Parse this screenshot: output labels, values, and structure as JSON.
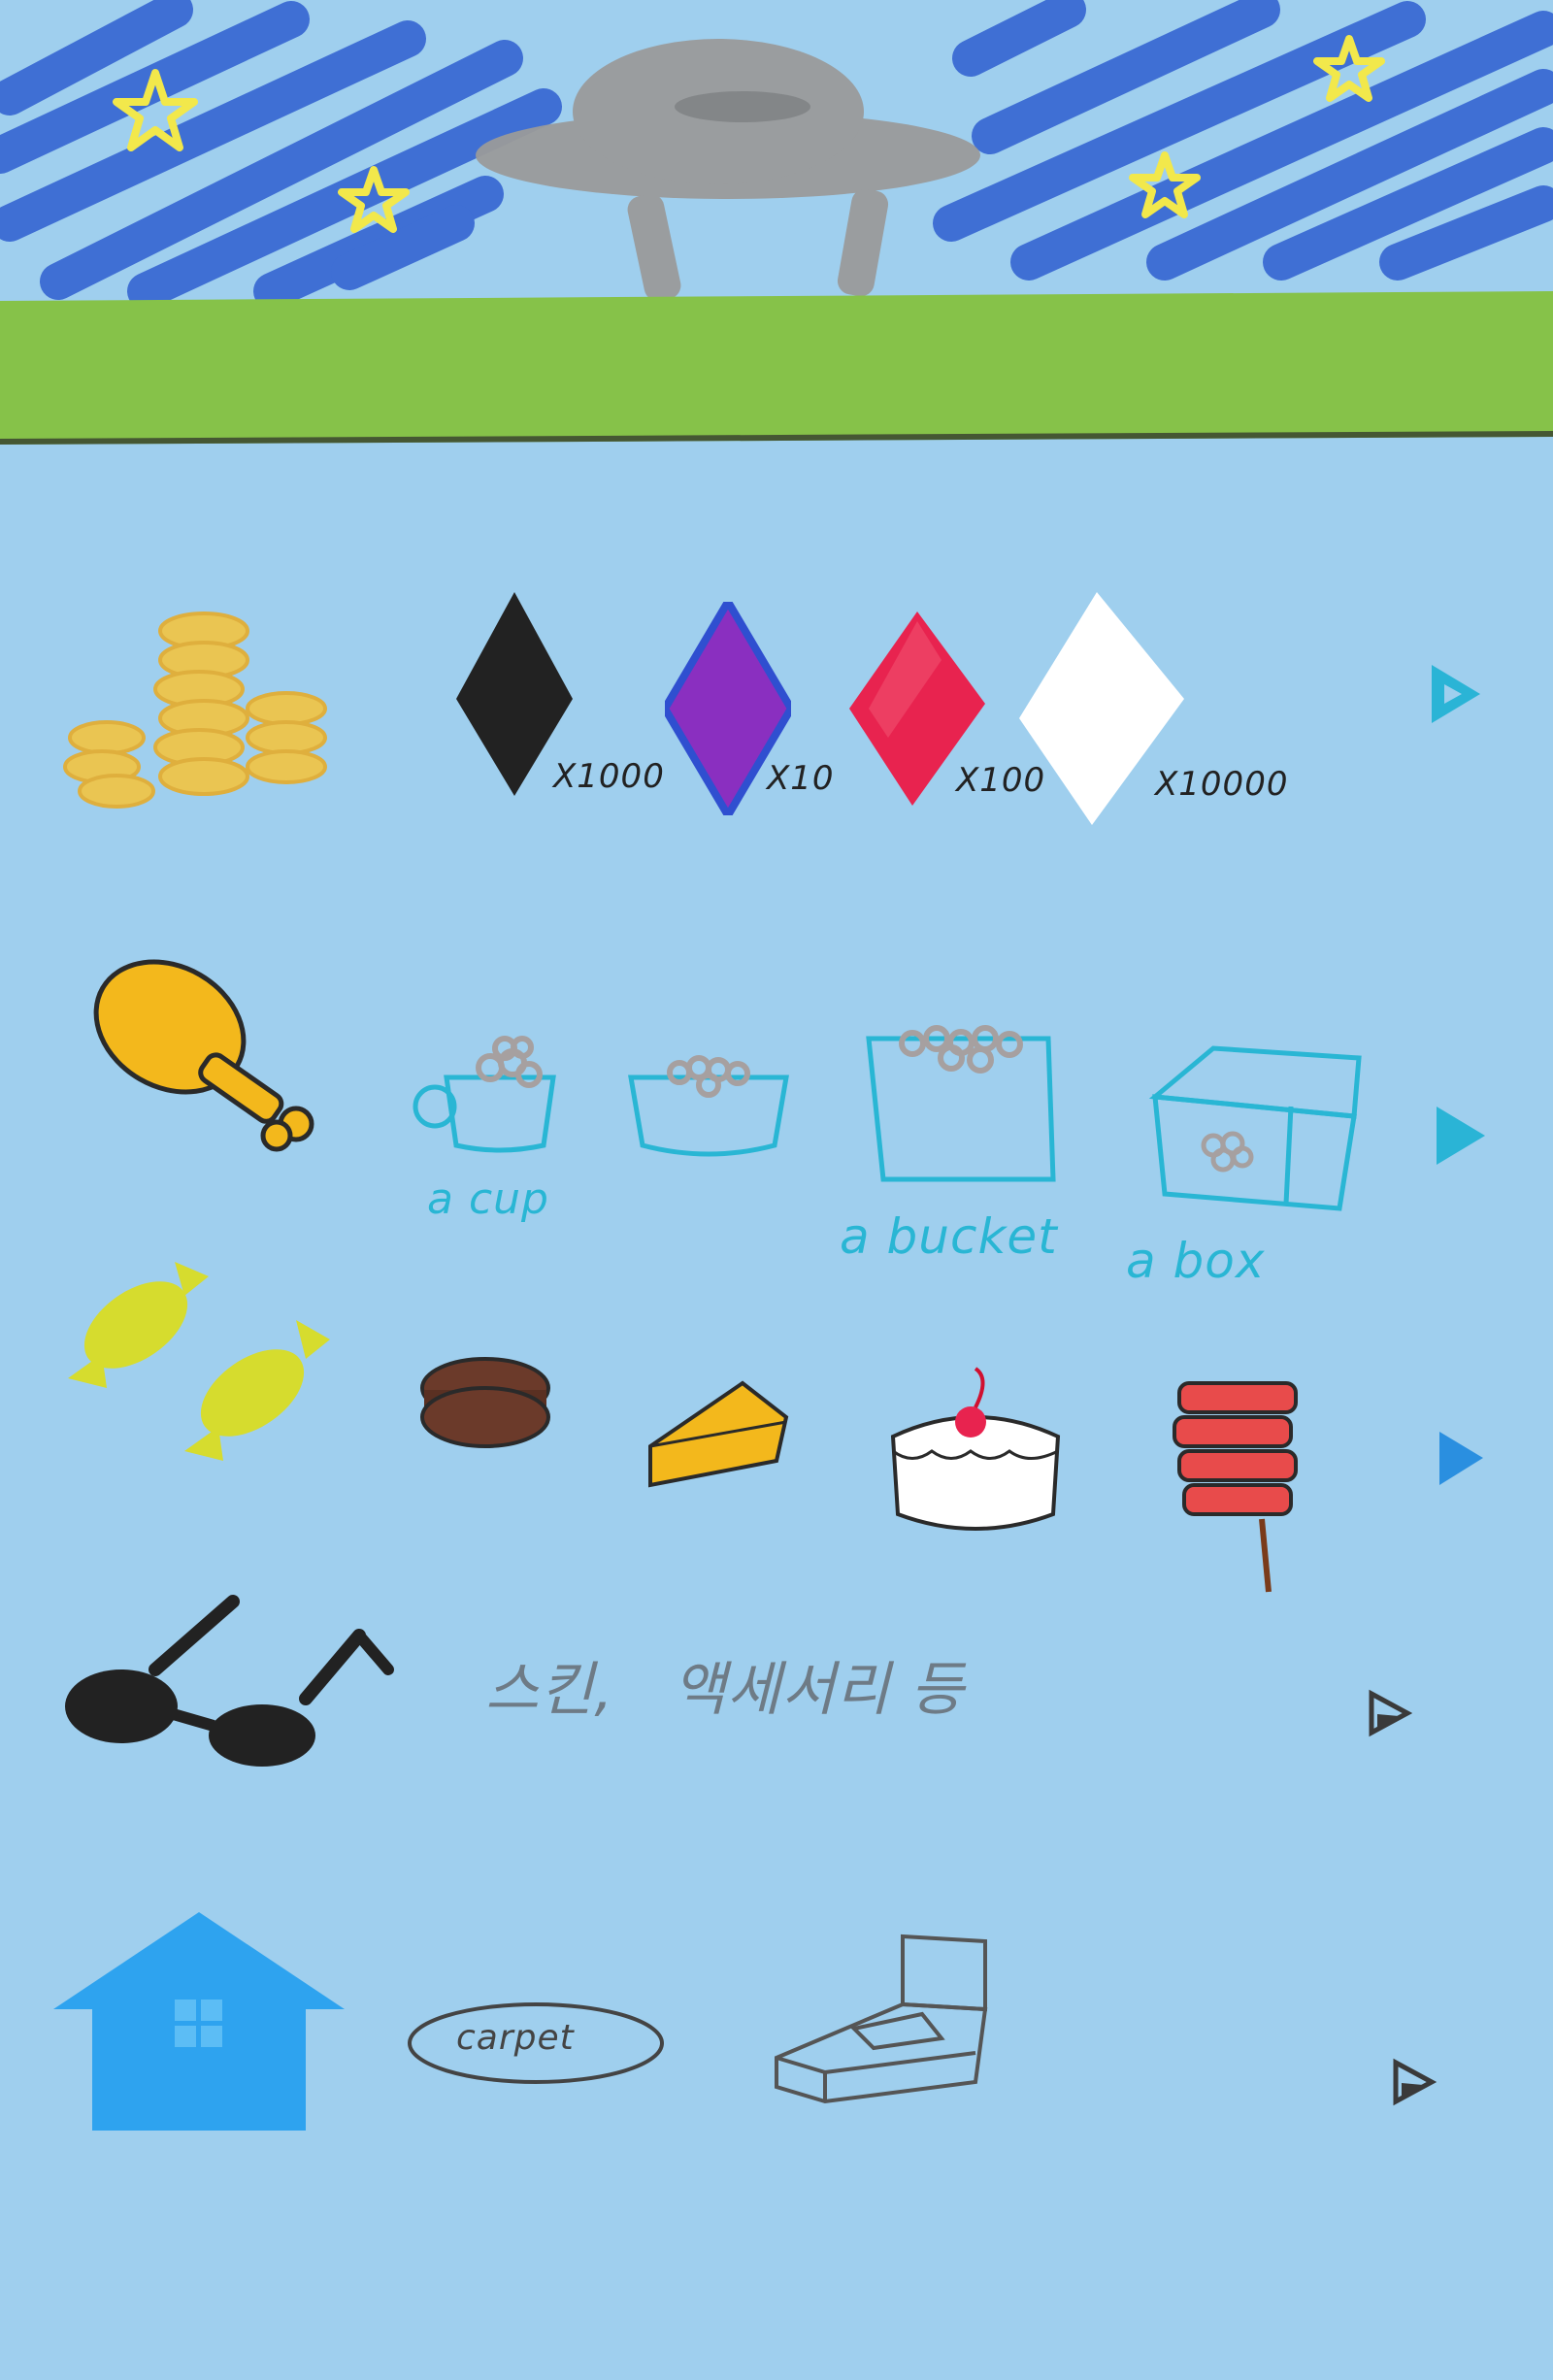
{
  "colors": {
    "sky": "#9fcfee",
    "night_scribble": "#2f5fd0",
    "grass": "#86c249",
    "star": "#f2e84b",
    "ufo": "#9a9a9a",
    "coin": "#f3c442",
    "label_cyan": "#29b6d4",
    "arrow_cyan": "#2ab4d6",
    "arrow_blue": "#2a8fe0",
    "arrow_dark": "#3a3a3a"
  },
  "rows": {
    "currency": {
      "icon": "coins-icon",
      "items": [
        {
          "icon": "black-gem-icon",
          "color": "#222222",
          "label": "X1000"
        },
        {
          "icon": "purple-gem-icon",
          "color": "#8a2fc0",
          "label": "X10"
        },
        {
          "icon": "red-gem-icon",
          "color": "#e8234f",
          "label": "X100"
        },
        {
          "icon": "white-gem-icon",
          "color": "#ffffff",
          "label": "X10000"
        }
      ],
      "arrow": "play-arrow-icon"
    },
    "food": {
      "icon": "chicken-leg-icon",
      "items": [
        {
          "icon": "cup-icon",
          "label": "a cup"
        },
        {
          "icon": "bowl-icon",
          "label": ""
        },
        {
          "icon": "bucket-icon",
          "label": "a bucket"
        },
        {
          "icon": "box-icon",
          "label": "a box"
        }
      ],
      "arrow": "play-arrow-icon"
    },
    "snacks": {
      "icon": "candy-icon",
      "items": [
        {
          "icon": "macaron-icon"
        },
        {
          "icon": "cheesecake-icon"
        },
        {
          "icon": "cherry-cake-icon"
        },
        {
          "icon": "skewer-icon"
        }
      ],
      "arrow": "play-arrow-icon"
    },
    "accessories": {
      "icon": "sunglasses-icon",
      "text": "스킨,   액세서리 등",
      "arrow": "play-arrow-icon"
    },
    "home": {
      "icon": "house-icon",
      "items": [
        {
          "icon": "carpet-icon",
          "label": "carpet"
        },
        {
          "icon": "bed-icon"
        }
      ],
      "arrow": "play-arrow-icon"
    }
  }
}
